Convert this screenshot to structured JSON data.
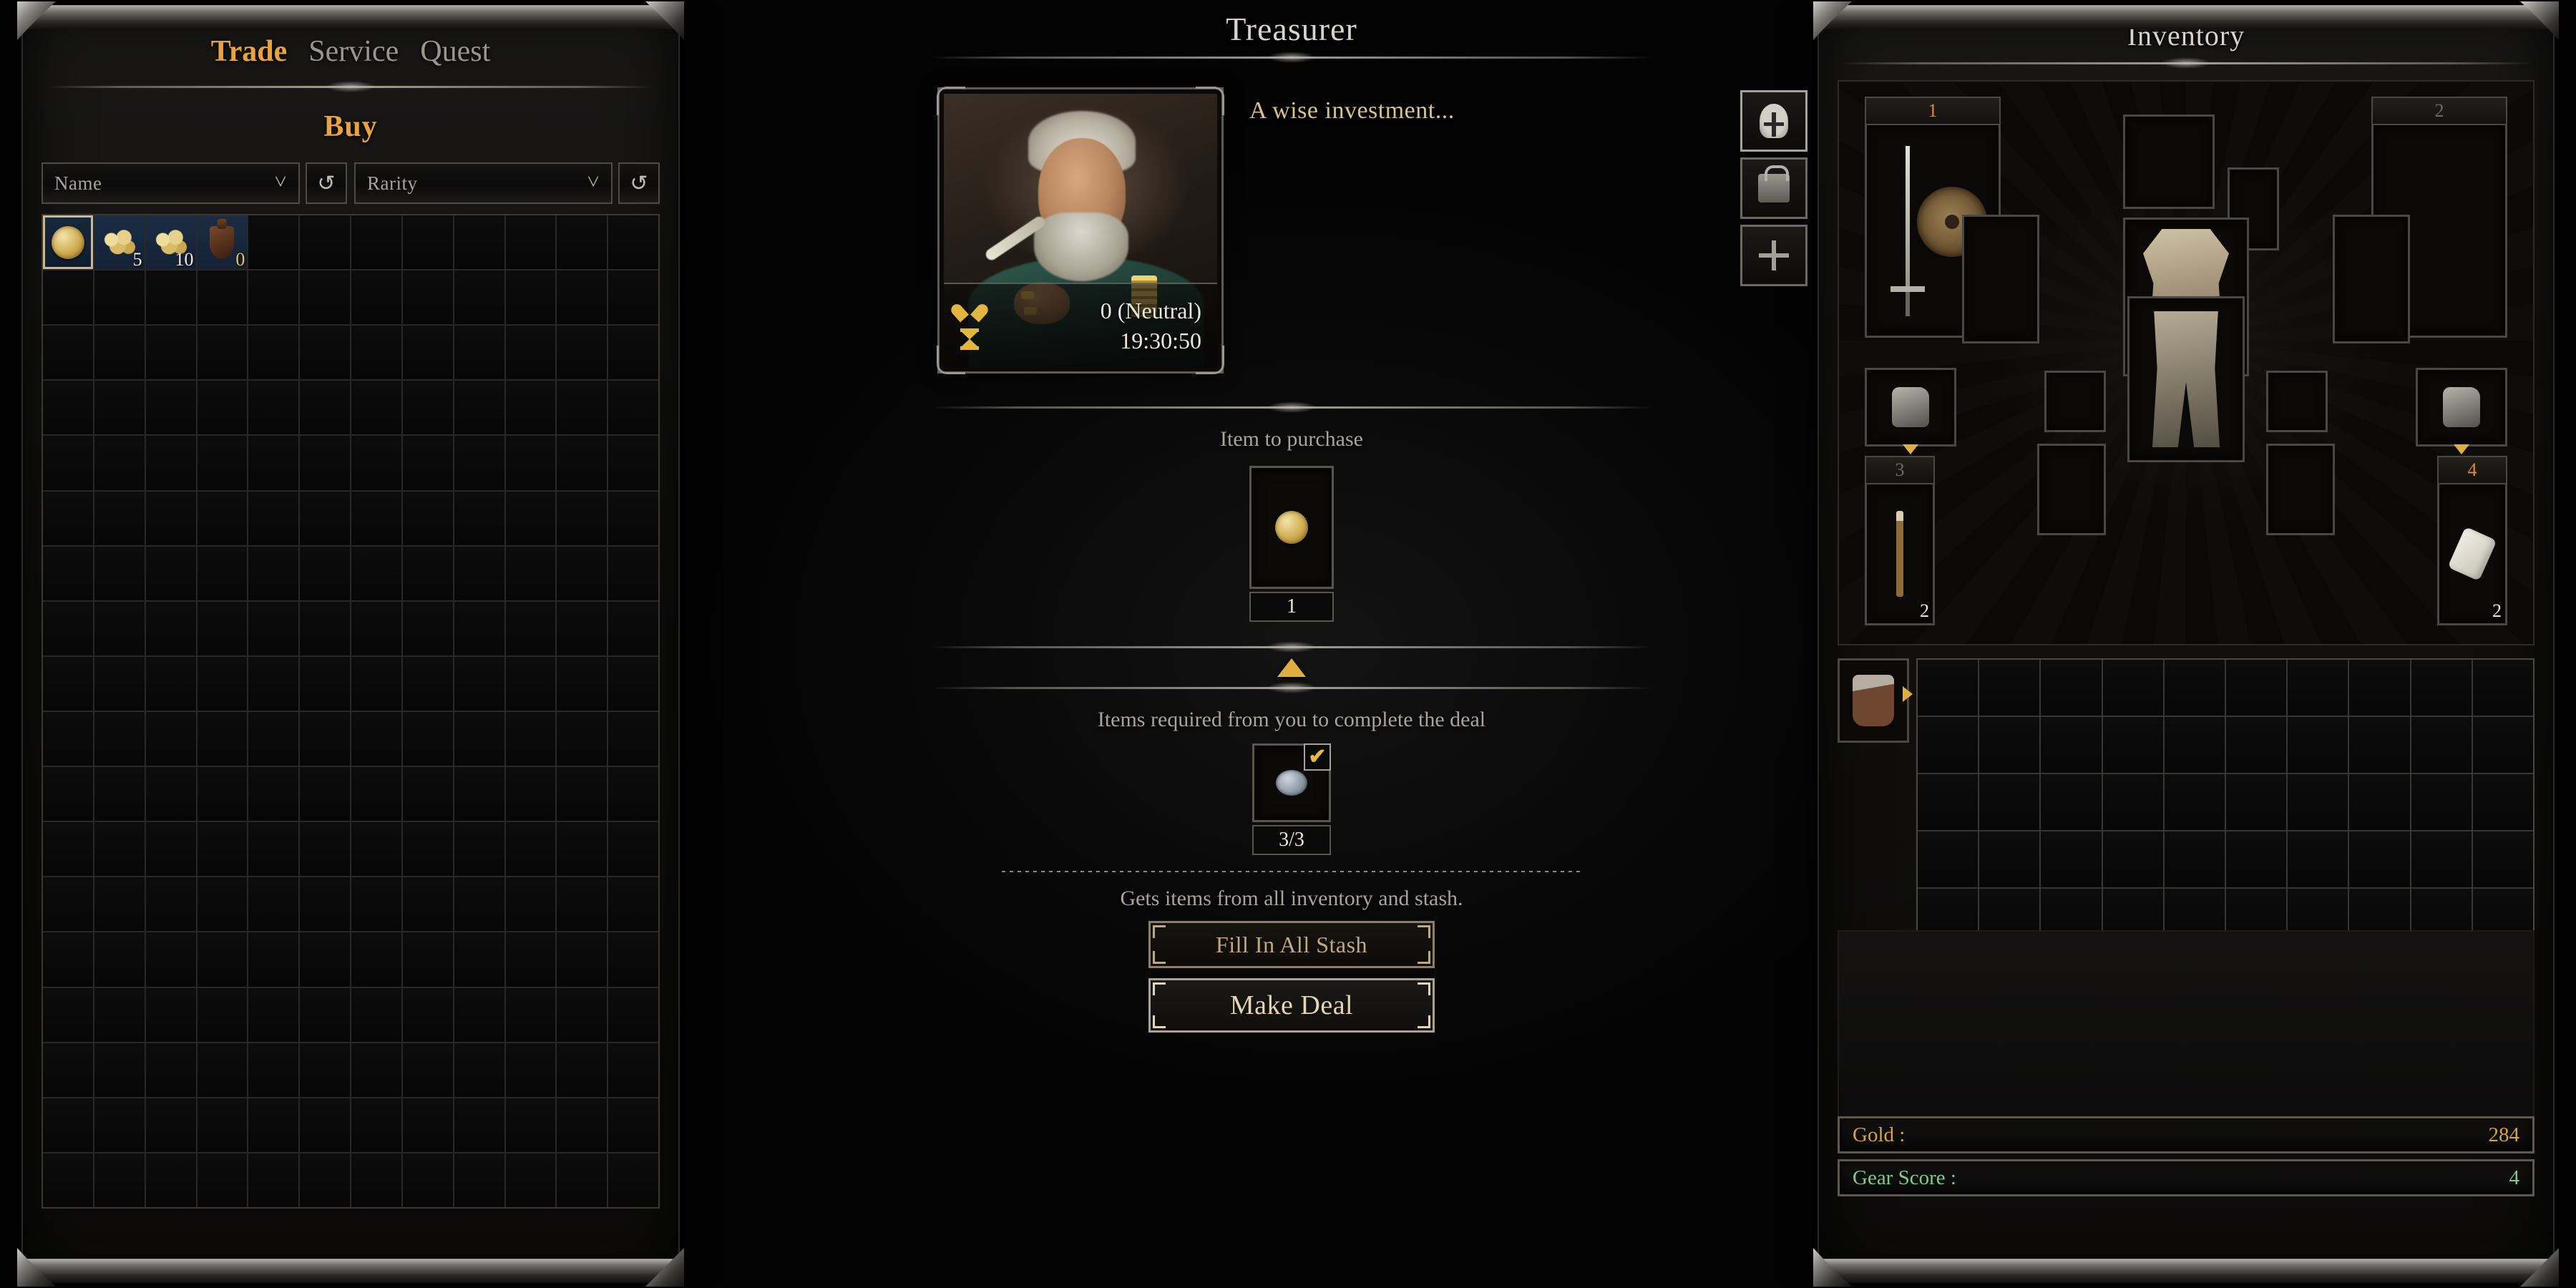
{
  "shop": {
    "tabs": [
      {
        "label": "Trade",
        "active": true
      },
      {
        "label": "Service",
        "active": false
      },
      {
        "label": "Quest",
        "active": false
      }
    ],
    "mode_label": "Buy",
    "filters": {
      "name_sort": "Name",
      "rarity_sort": "Rarity",
      "refresh_icon": "refresh-icon",
      "chevron_icon": "chevron-down-icon"
    },
    "grid": {
      "columns": 12,
      "rows": 18
    },
    "items": [
      {
        "icon": "gold-coin-icon",
        "qty": "",
        "selected": true
      },
      {
        "icon": "gold-pile-icon",
        "qty": "5",
        "selected": false
      },
      {
        "icon": "gold-pile-icon",
        "qty": "10",
        "selected": false
      },
      {
        "icon": "clay-jug-icon",
        "qty": "0",
        "selected": false,
        "qty_gold": true
      }
    ]
  },
  "merchant": {
    "title": "Treasurer",
    "quote": "A wise investment...",
    "reputation": "0 (Neutral)",
    "timer": "19:30:50",
    "reputation_icon": "heart-icon",
    "timer_icon": "hourglass-icon",
    "purchase": {
      "label": "Item to purchase",
      "item_icon": "gold-coin-icon",
      "quantity": "1"
    },
    "arrow_icon": "arrow-up-icon",
    "required": {
      "label": "Items required from you to complete the deal",
      "item_icon": "silver-coin-icon",
      "progress": "3/3",
      "check_icon": "checkmark-icon",
      "check_glyph": "✔"
    },
    "hint": "Gets items from all inventory and stash.",
    "buttons": {
      "fill_stash": "Fill In All Stash",
      "make_deal": "Make Deal"
    }
  },
  "inventory": {
    "title": "Inventory",
    "side_tabs": [
      {
        "icon": "helmet-icon",
        "active": true
      },
      {
        "icon": "backpack-icon",
        "active": false
      },
      {
        "icon": "plus-icon",
        "active": false
      }
    ],
    "weapon_sets": [
      {
        "number": "1",
        "active": true
      },
      {
        "number": "2",
        "active": false
      }
    ],
    "quick_slots": [
      {
        "number": "3",
        "active": false,
        "count": "2",
        "icon": "wand-icon"
      },
      {
        "number": "4",
        "active": true,
        "count": "2",
        "icon": "scroll-icon"
      }
    ],
    "equipment": [
      {
        "slot": "main-hand-weapon",
        "icon": "sword-icon"
      },
      {
        "slot": "off-hand-shield",
        "icon": "round-shield-icon"
      },
      {
        "slot": "chest-armor",
        "icon": "chest-armor-icon"
      },
      {
        "slot": "leg-armor",
        "icon": "pants-icon"
      },
      {
        "slot": "left-glove",
        "icon": "glove-icon"
      },
      {
        "slot": "right-glove",
        "icon": "glove-icon"
      }
    ],
    "bag": {
      "slot_icon": "satchel-icon",
      "columns": 10,
      "rows": 5
    },
    "stats": [
      {
        "label": "Gold :",
        "value": "284",
        "color": "#d9a23c"
      },
      {
        "label": "Gear Score :",
        "value": "4",
        "color": "#7ecb84"
      }
    ]
  },
  "colors": {
    "accent_gold": "#e8a33d",
    "text_grey": "#9a968e",
    "stat_green": "#7ecb84",
    "frame": "#5b5751"
  }
}
